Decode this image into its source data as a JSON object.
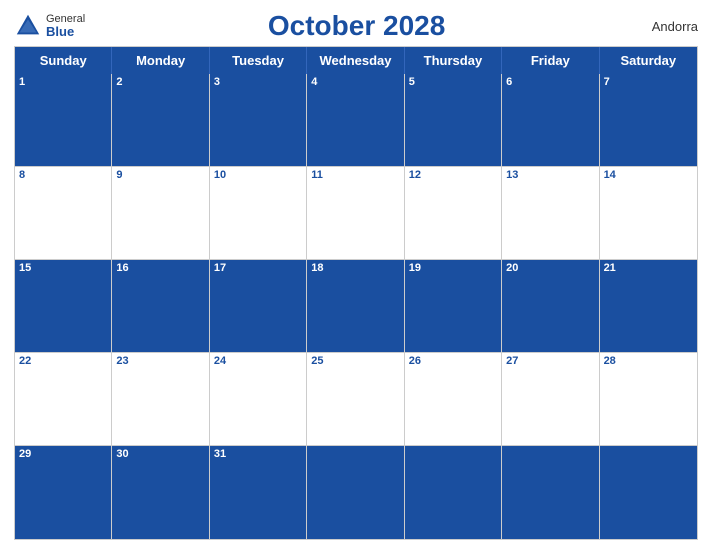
{
  "header": {
    "logo": {
      "general": "General",
      "blue": "Blue",
      "icon": "▲"
    },
    "title": "October 2028",
    "country": "Andorra"
  },
  "days": [
    "Sunday",
    "Monday",
    "Tuesday",
    "Wednesday",
    "Thursday",
    "Friday",
    "Saturday"
  ],
  "weeks": [
    {
      "row_type": "blue",
      "cells": [
        1,
        2,
        3,
        4,
        5,
        6,
        7
      ]
    },
    {
      "row_type": "white",
      "cells": [
        8,
        9,
        10,
        11,
        12,
        13,
        14
      ]
    },
    {
      "row_type": "blue",
      "cells": [
        15,
        16,
        17,
        18,
        19,
        20,
        21
      ]
    },
    {
      "row_type": "white",
      "cells": [
        22,
        23,
        24,
        25,
        26,
        27,
        28
      ]
    },
    {
      "row_type": "blue",
      "cells": [
        29,
        30,
        31,
        null,
        null,
        null,
        null
      ]
    }
  ]
}
